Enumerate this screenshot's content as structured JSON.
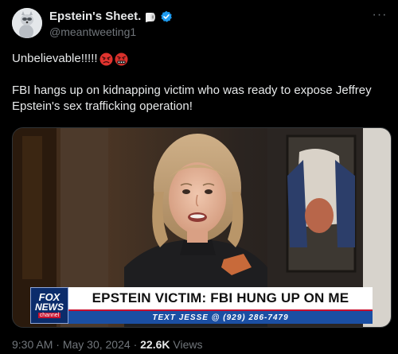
{
  "author": {
    "display_name": "Epstein's Sheet.",
    "handle": "@meantweeting1",
    "avatar_icon": "raccoon-avatar",
    "emoji_after_name": "toilet-paper-icon",
    "verified_badge_color": "#1d9bf0"
  },
  "more_label": "···",
  "post": {
    "line1": "Unbelievable!!!!!",
    "line1_emojis": [
      "angry-face-icon",
      "cursing-face-icon"
    ],
    "paragraph2": "FBI hangs up on kidnapping victim who was ready to expose Jeffrey Epstein's sex trafficking operation!"
  },
  "media": {
    "logo_fox": "FOX",
    "logo_news": "NEWS",
    "logo_channel": "channel",
    "headline": "EPSTEIN VICTIM: FBI HUNG UP ON ME",
    "ticker": "TEXT JESSE @ (929) 286-7479"
  },
  "meta": {
    "time": "9:30 AM",
    "separator": "·",
    "date": "May 30, 2024",
    "views_count": "22.6K",
    "views_label": "Views"
  },
  "colors": {
    "background": "#000000",
    "text": "#e7e9ea",
    "muted": "#71767b",
    "fox_blue": "#1b4fa3",
    "fox_red": "#c8102e"
  }
}
